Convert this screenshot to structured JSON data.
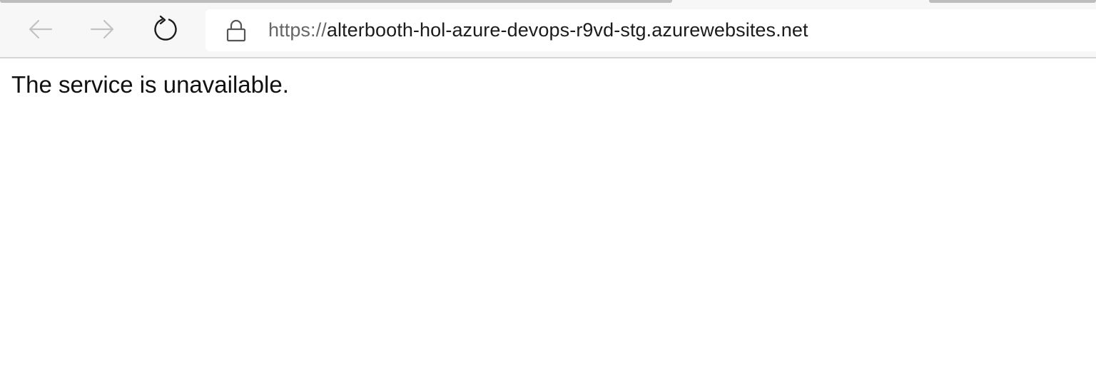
{
  "toolbar": {
    "back_icon": "back-arrow-icon",
    "forward_icon": "forward-arrow-icon",
    "reload_icon": "reload-icon",
    "lock_icon": "lock-icon"
  },
  "address_bar": {
    "scheme": "https://",
    "host": "alterbooth-hol-azure-devops-r9vd-stg.azurewebsites.net"
  },
  "page": {
    "message": "The service is unavailable."
  },
  "colors": {
    "toolbar_bg": "#f7f7f7",
    "disabled_icon": "#c2c2c2",
    "active_icon": "#1b1b1b",
    "url_scheme": "#666666"
  }
}
